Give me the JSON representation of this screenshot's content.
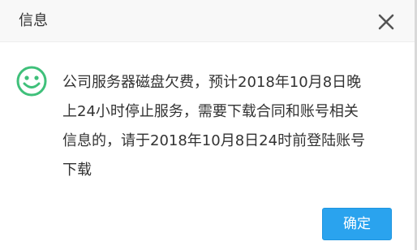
{
  "dialog": {
    "title": "信息",
    "close_icon": "close-icon",
    "status_icon": "smile-icon",
    "status_color": "#3fc07a",
    "message_lines": "公司服务器磁盘欠费，预计2018年10月8日晚\n上24小时停止服务，需要下载合同和账号相关\n信息的，请于2018年10月8日24时前登陆账号\n下载",
    "confirm_label": "确定",
    "accent_color": "#2aa3ee"
  }
}
